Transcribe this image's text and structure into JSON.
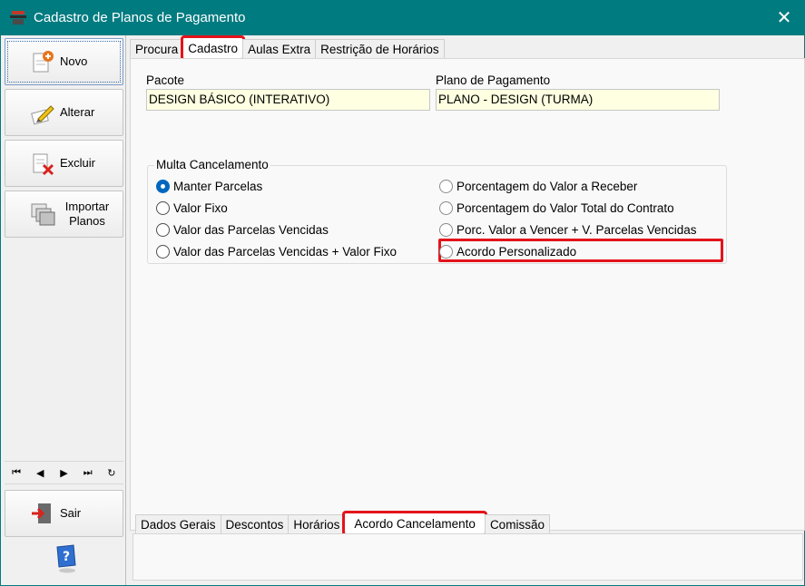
{
  "window": {
    "title": "Cadastro de Planos de Pagamento",
    "close_glyph": "✕",
    "accent_color": "#007b80",
    "highlight_color": "#e3141b"
  },
  "sidebar": {
    "buttons": [
      {
        "label": "Novo",
        "icon": "new-document-icon"
      },
      {
        "label": "Alterar",
        "icon": "edit-icon"
      },
      {
        "label": "Excluir",
        "icon": "delete-icon"
      },
      {
        "label": "Importar Planos",
        "icon": "import-icon"
      }
    ],
    "nav": [
      "⏮",
      "◀",
      "▶",
      "⏭",
      "↻"
    ],
    "exit_label": "Sair",
    "help_icon": "help-icon"
  },
  "top_tabs": [
    {
      "label": "Procura"
    },
    {
      "label": "Cadastro"
    },
    {
      "label": "Aulas Extra"
    },
    {
      "label": "Restrição de Horários"
    }
  ],
  "form": {
    "pacote_label": "Pacote",
    "pacote_value": "DESIGN BÁSICO (INTERATIVO)",
    "plano_label": "Plano de Pagamento",
    "plano_value": "PLANO - DESIGN (TURMA)",
    "multa_legend": "Multa Cancelamento",
    "options": [
      "Manter Parcelas",
      "Valor Fixo",
      "Valor das Parcelas Vencidas",
      "Valor das Parcelas Vencidas + Valor Fixo",
      "Porcentagem do Valor a Receber",
      "Porcentagem do Valor Total do Contrato",
      "Porc. Valor a Vencer + V. Parcelas Vencidas",
      "Acordo Personalizado"
    ],
    "selected_option": "Manter Parcelas"
  },
  "bottom_tabs": [
    {
      "label": "Dados Gerais"
    },
    {
      "label": "Descontos"
    },
    {
      "label": "Horários"
    },
    {
      "label": "Acordo Cancelamento"
    },
    {
      "label": "Comissão"
    }
  ]
}
